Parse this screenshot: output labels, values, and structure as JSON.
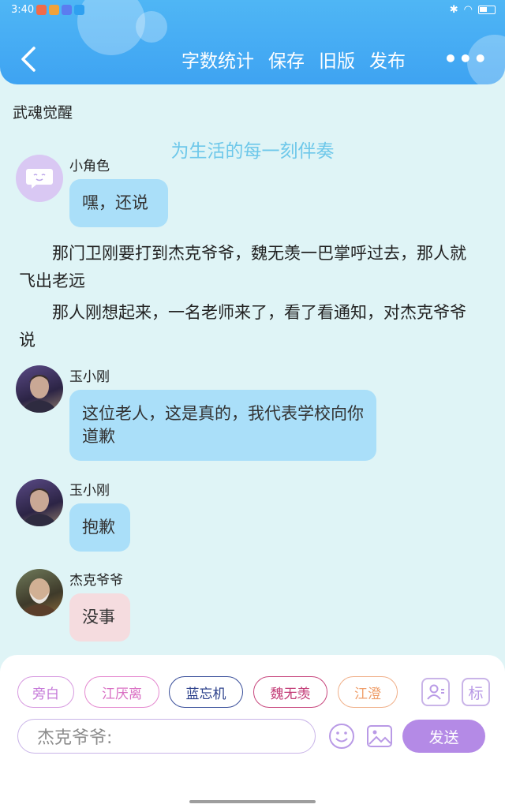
{
  "status_bar": {
    "time": "3:40"
  },
  "nav": {
    "actions": [
      "字数统计",
      "保存",
      "旧版",
      "发布"
    ],
    "more": "•••"
  },
  "story": {
    "title": "武魂觉醒",
    "watermark": "为生活的每一刻伴奏"
  },
  "messages": [
    {
      "type": "dialog",
      "name": "小角色",
      "text": "嘿，还说"
    },
    {
      "type": "narration",
      "text": "那门卫刚要打到杰克爷爷，魏无羡一巴掌呼过去，那人就飞出老远"
    },
    {
      "type": "narration",
      "text": "那人刚想起来，一名老师来了，看了看通知，对杰克爷爷说"
    },
    {
      "type": "dialog",
      "name": "玉小刚",
      "text": "这位老人，这是真的，我代表学校向你道歉"
    },
    {
      "type": "dialog",
      "name": "玉小刚",
      "text": "抱歉"
    },
    {
      "type": "dialog",
      "name": "杰克爷爷",
      "text": "没事"
    }
  ],
  "characters": [
    "旁白",
    "江厌离",
    "蓝忘机",
    "魏无羡",
    "江澄"
  ],
  "tools": {
    "mark_label": "标"
  },
  "input": {
    "placeholder": "杰克爷爷:"
  },
  "send_label": "发送",
  "colors": {
    "header": "#3ea3f2",
    "bubble_blue": "#aadff9",
    "bubble_pink": "#f5dcdf",
    "send": "#b48ae6",
    "chip_borders": [
      "#d79ae0",
      "#e58ad0",
      "#3a4f9a",
      "#c8487e",
      "#f0b08a"
    ],
    "chip_text": [
      "#c579d8",
      "#d96fc3",
      "#2a3f8a",
      "#c23a75",
      "#ef9e6a"
    ]
  }
}
